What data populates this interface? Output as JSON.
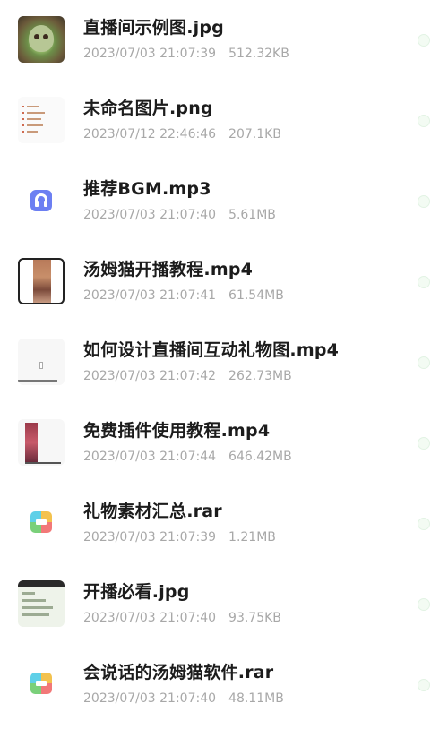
{
  "files": [
    {
      "name": "直播间示例图.jpg",
      "date": "2023/07/03 21:07:39",
      "size": "512.32KB",
      "thumb": "cat-photo"
    },
    {
      "name": "未命名图片.png",
      "date": "2023/07/12 22:46:46",
      "size": "207.1KB",
      "thumb": "list-image"
    },
    {
      "name": "推荐BGM.mp3",
      "date": "2023/07/03 21:07:40",
      "size": "5.61MB",
      "thumb": "audio-icon"
    },
    {
      "name": "汤姆猫开播教程.mp4",
      "date": "2023/07/03 21:07:41",
      "size": "61.54MB",
      "thumb": "video-thumb"
    },
    {
      "name": "如何设计直播间互动礼物图.mp4",
      "date": "2023/07/03 21:07:42",
      "size": "262.73MB",
      "thumb": "video-thumb"
    },
    {
      "name": "免费插件使用教程.mp4",
      "date": "2023/07/03 21:07:44",
      "size": "646.42MB",
      "thumb": "video-thumb"
    },
    {
      "name": "礼物素材汇总.rar",
      "date": "2023/07/03 21:07:39",
      "size": "1.21MB",
      "thumb": "archive-icon"
    },
    {
      "name": "开播必看.jpg",
      "date": "2023/07/03 21:07:40",
      "size": "93.75KB",
      "thumb": "document-image"
    },
    {
      "name": "会说话的汤姆猫软件.rar",
      "date": "2023/07/03 21:07:40",
      "size": "48.11MB",
      "thumb": "archive-icon"
    }
  ]
}
